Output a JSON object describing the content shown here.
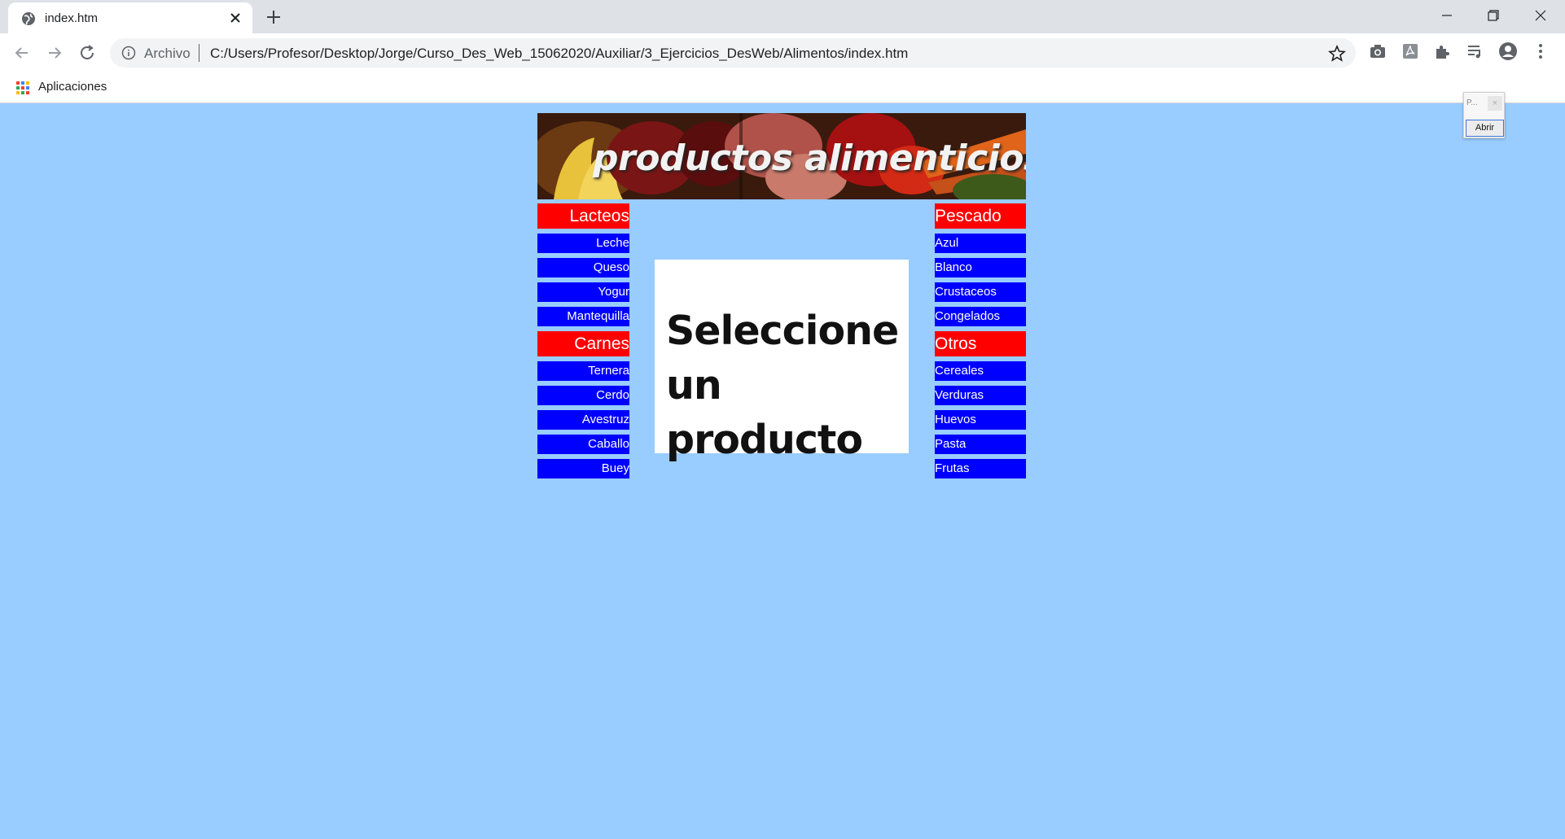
{
  "browser": {
    "tab_title": "index.htm",
    "scheme_label": "Archivo",
    "url": "C:/Users/Profesor/Desktop/Jorge/Curso_Des_Web_15062020/Auxiliar/3_Ejercicios_DesWeb/Alimentos/index.htm",
    "bookmark_apps_label": "Aplicaciones"
  },
  "banner": {
    "title": "productos alimenticios"
  },
  "left_menu": {
    "groups": [
      {
        "title": "Lacteos",
        "items": [
          "Leche",
          "Queso",
          "Yogur",
          "Mantequilla"
        ]
      },
      {
        "title": "Carnes",
        "items": [
          "Ternera",
          "Cerdo",
          "Avestruz",
          "Caballo",
          "Buey"
        ]
      }
    ]
  },
  "right_menu": {
    "groups": [
      {
        "title": "Pescado",
        "items": [
          "Azul",
          "Blanco",
          "Crustaceos",
          "Congelados"
        ]
      },
      {
        "title": "Otros",
        "items": [
          "Cereales",
          "Verduras",
          "Huevos",
          "Pasta",
          "Frutas"
        ]
      }
    ]
  },
  "center": {
    "line1": "Seleccione",
    "line2": "un producto"
  },
  "popup": {
    "title": "P...",
    "close": "×",
    "button": "Abrir"
  },
  "colors": {
    "page_background": "#99ccff",
    "category_background": "#ff0000",
    "item_background": "#0000ff"
  }
}
